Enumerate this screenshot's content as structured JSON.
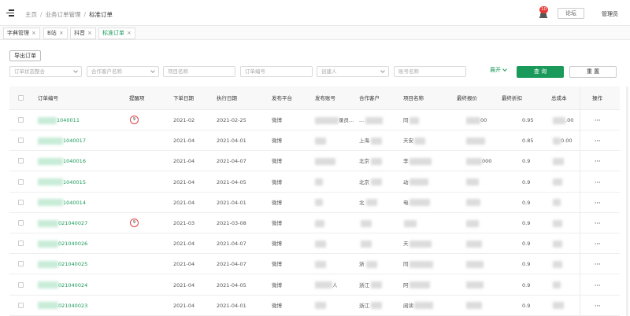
{
  "header": {
    "breadcrumb": [
      "主页",
      "业务订单管理",
      "标准订单"
    ],
    "notification_count": "10",
    "forum_label": "论坛",
    "user_label": "管理员"
  },
  "tabs": [
    {
      "label": "字典管理",
      "active": false
    },
    {
      "label": "B站",
      "active": false
    },
    {
      "label": "抖音",
      "active": false
    },
    {
      "label": "标准订单",
      "active": true
    }
  ],
  "toolbar": {
    "export_label": "导出订单"
  },
  "filters": [
    {
      "placeholder": "订单状态整合",
      "dropdown": true
    },
    {
      "placeholder": "合作客户名称",
      "dropdown": true
    },
    {
      "placeholder": "项目名称",
      "dropdown": false
    },
    {
      "placeholder": "订单编号",
      "dropdown": false
    },
    {
      "placeholder": "创建人",
      "dropdown": true
    },
    {
      "placeholder": "账号名称",
      "dropdown": false
    }
  ],
  "actions": {
    "expand_label": "展开",
    "query_label": "查 询",
    "reset_label": "重 置"
  },
  "table": {
    "columns": [
      "订单编号",
      "提醒项",
      "下单日期",
      "执行日期",
      "发布平台",
      "发布账号",
      "合作客户",
      "项目名称",
      "最终报价",
      "最终折扣",
      "总成本",
      "操作"
    ],
    "rows": [
      {
        "id_suffix": "1040011",
        "remind": "9",
        "order_date": "2021-02",
        "exec_date": "2021-02-25",
        "platform": "微博",
        "account": "录员...",
        "client": "...",
        "project": "同",
        "price": "00",
        "discount": "0.95",
        "cost": ".00",
        "op": "···"
      },
      {
        "id_suffix": "1040017",
        "remind": "",
        "order_date": "2021-04",
        "exec_date": "2021-04-01",
        "platform": "微博",
        "account": "",
        "client": "上海",
        "project": "天安",
        "price": "",
        "discount": "0.85",
        "cost": "0.00",
        "op": "···"
      },
      {
        "id_suffix": "1040016",
        "remind": "",
        "order_date": "2021-04",
        "exec_date": "2021-04-07",
        "platform": "微博",
        "account": "",
        "client": "北京",
        "project": "李",
        "price": "000",
        "discount": "0.9",
        "cost": "",
        "op": "···"
      },
      {
        "id_suffix": "1040015",
        "remind": "",
        "order_date": "2021-04",
        "exec_date": "2021-04-05",
        "platform": "微博",
        "account": "",
        "client": "北京",
        "project": "动",
        "price": "",
        "discount": "0.9",
        "cost": "",
        "op": "···"
      },
      {
        "id_suffix": "1040014",
        "remind": "",
        "order_date": "2021-04",
        "exec_date": "2021-04-01",
        "platform": "微博",
        "account": "",
        "client": "北",
        "project": "电",
        "price": "",
        "discount": "0.9",
        "cost": "",
        "op": "···"
      },
      {
        "id_suffix": "021040027",
        "remind": "9",
        "order_date": "2021-03",
        "exec_date": "2021-03-08",
        "platform": "微博",
        "account": "",
        "client": "",
        "project": "",
        "price": "",
        "discount": "0.9",
        "cost": "",
        "op": "···"
      },
      {
        "id_suffix": "021040026",
        "remind": "",
        "order_date": "2021-04",
        "exec_date": "2021-04-07",
        "platform": "微博",
        "account": "",
        "client": "",
        "project": "天",
        "price": "",
        "discount": "0.9",
        "cost": "",
        "op": "···"
      },
      {
        "id_suffix": "021040025",
        "remind": "",
        "order_date": "2021-04",
        "exec_date": "2021-04-07",
        "platform": "微博",
        "account": "",
        "client": "浙",
        "project": "同",
        "price": "",
        "discount": "0.9",
        "cost": "",
        "op": "···"
      },
      {
        "id_suffix": "021040024",
        "remind": "",
        "order_date": "2021-04",
        "exec_date": "2021-04-05",
        "platform": "微博",
        "account": "人",
        "client": "浙江",
        "project": "阿",
        "price": "",
        "discount": "0.9",
        "cost": "",
        "op": "···"
      },
      {
        "id_suffix": "021040023",
        "remind": "",
        "order_date": "2021-04",
        "exec_date": "2021-04-01",
        "platform": "微博",
        "account": "",
        "client": "浙江",
        "project": "阅读",
        "price": "",
        "discount": "0.9",
        "cost": "",
        "op": "···"
      }
    ]
  }
}
